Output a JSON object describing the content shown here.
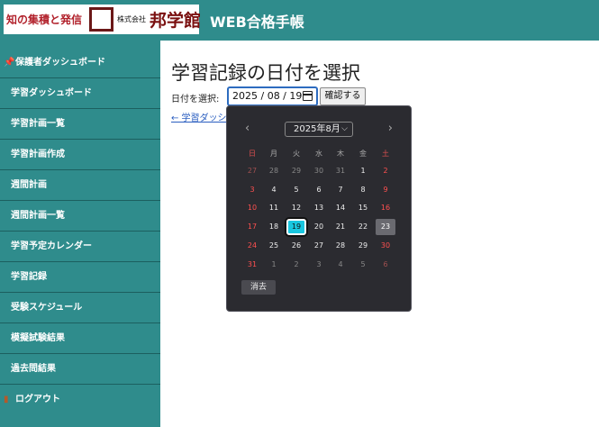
{
  "header": {
    "logo_text1": "知の集積と発信",
    "logo_text2": "株式会社",
    "logo_text3": "邦学館",
    "app_title": "WEB合格手帳"
  },
  "sidebar": {
    "items": [
      {
        "label": "保護者ダッシュボード",
        "icon": "pin-icon"
      },
      {
        "label": "学習ダッシュボード"
      },
      {
        "label": "学習計画一覧"
      },
      {
        "label": "学習計画作成"
      },
      {
        "label": "週間計画"
      },
      {
        "label": "週間計画一覧"
      },
      {
        "label": "学習予定カレンダー"
      },
      {
        "label": "学習記録"
      },
      {
        "label": "受験スケジュール"
      },
      {
        "label": "模擬試験結果"
      },
      {
        "label": "過去問結果"
      },
      {
        "label": "ログアウト",
        "icon": "door-icon"
      }
    ]
  },
  "main": {
    "title": "学習記録の日付を選択",
    "date_label": "日付を選択:",
    "date_value": "2025 / 08 / 19",
    "confirm_button": "確認する",
    "back_link": "← 学習ダッシ"
  },
  "calendar": {
    "month_label": "2025年8月",
    "prev": "‹",
    "next": "›",
    "weekdays": [
      "日",
      "月",
      "火",
      "水",
      "木",
      "金",
      "土"
    ],
    "weeks": [
      [
        "27",
        "28",
        "29",
        "30",
        "31",
        "1",
        "2"
      ],
      [
        "3",
        "4",
        "5",
        "6",
        "7",
        "8",
        "9"
      ],
      [
        "10",
        "11",
        "12",
        "13",
        "14",
        "15",
        "16"
      ],
      [
        "17",
        "18",
        "19",
        "20",
        "21",
        "22",
        "23"
      ],
      [
        "24",
        "25",
        "26",
        "27",
        "28",
        "29",
        "30"
      ],
      [
        "31",
        "1",
        "2",
        "3",
        "4",
        "5",
        "6"
      ]
    ],
    "selected": "19",
    "today": "23",
    "clear_button": "消去"
  },
  "colors": {
    "header_bg": "#2f8c8c",
    "sidebar_bg": "#2f8c8c",
    "calendar_bg": "#2b2b30",
    "selected_day": "#19c7e0",
    "link": "#2a5ec0"
  }
}
